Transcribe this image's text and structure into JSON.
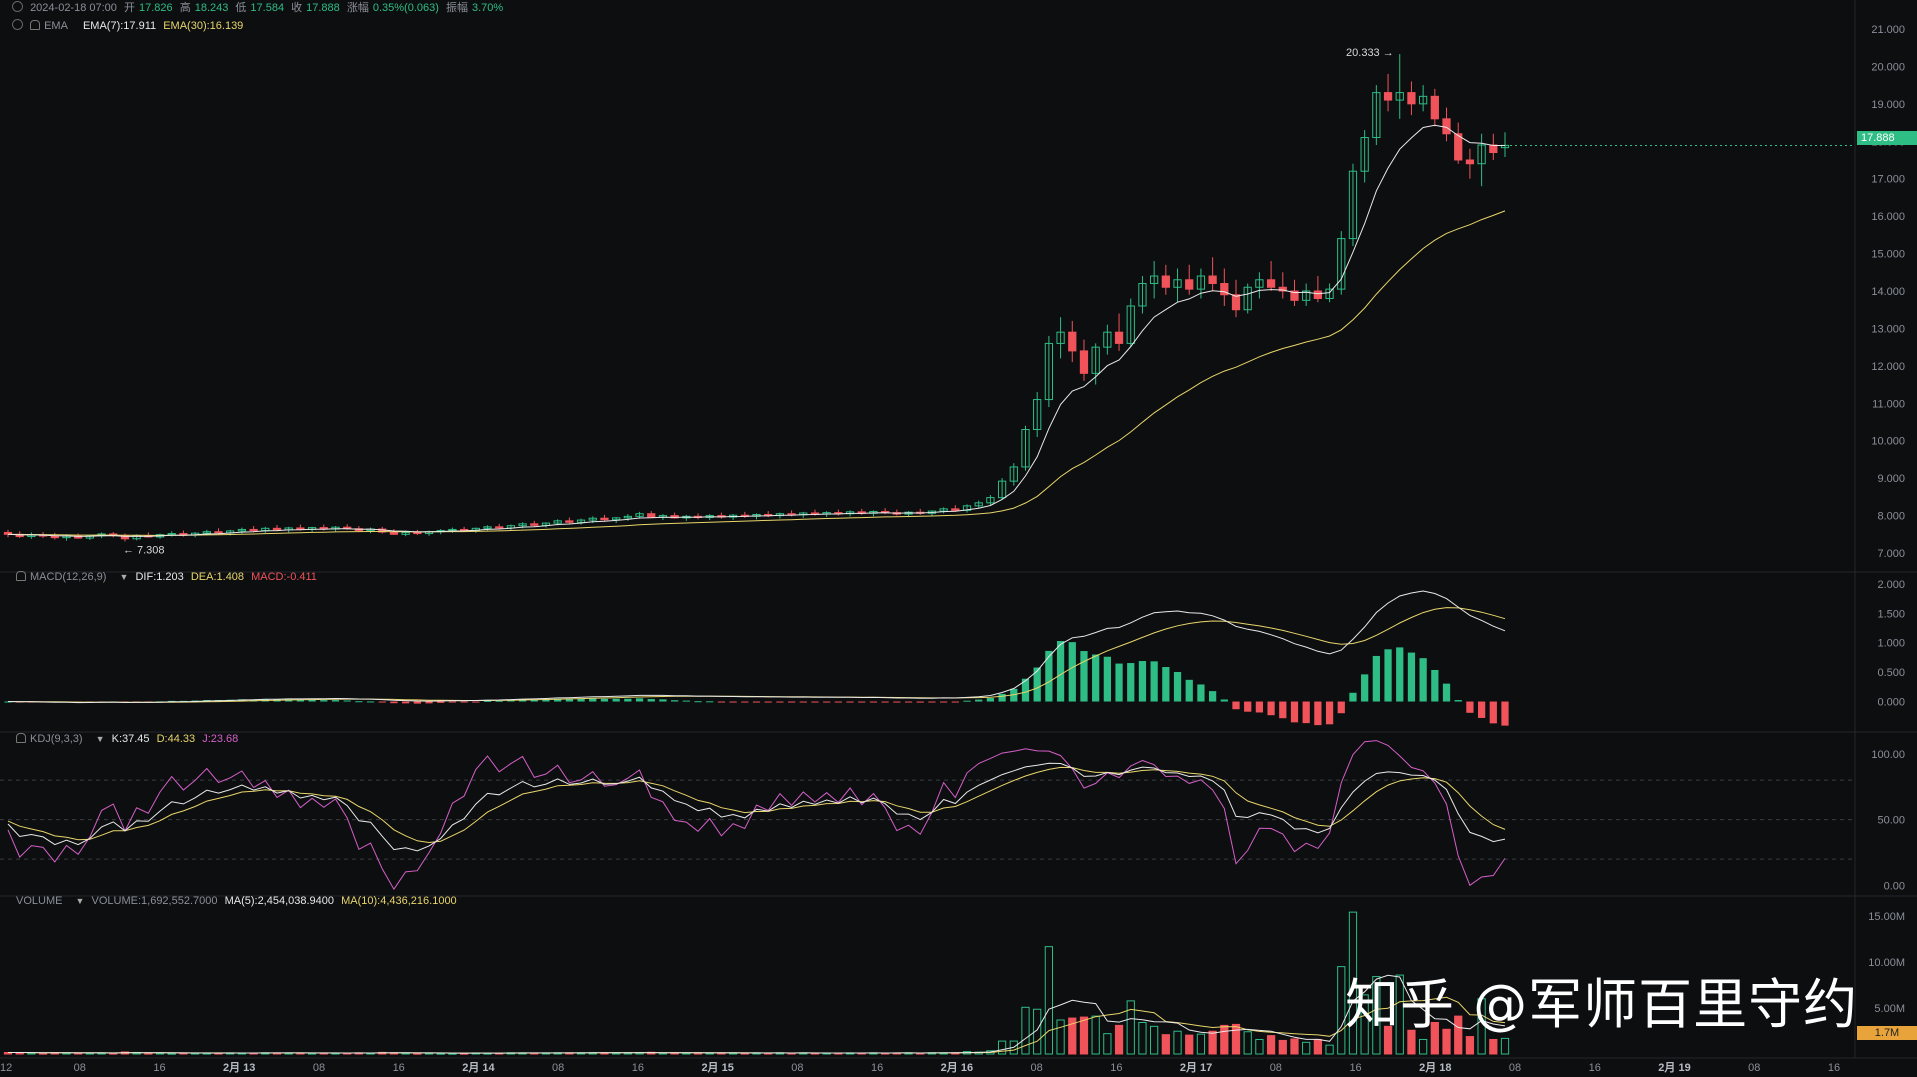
{
  "header": {
    "date": "2024-02-18 07:00",
    "open_label": "开",
    "open": "17.826",
    "high_label": "高",
    "high": "18.243",
    "low_label": "低",
    "low": "17.584",
    "close_label": "收",
    "close": "17.888",
    "change_label": "涨幅",
    "change": "0.35%(0.063)",
    "amp_label": "振幅",
    "amp": "3.70%"
  },
  "ema_legend": {
    "name": "EMA",
    "ema7": "EMA(7):17.911",
    "ema30": "EMA(30):16.139"
  },
  "macd_legend": {
    "name": "MACD(12,26,9)",
    "dif": "DIF:1.203",
    "dea": "DEA:1.408",
    "macd": "MACD:-0.411"
  },
  "kdj_legend": {
    "name": "KDJ(9,3,3)",
    "k": "K:37.45",
    "d": "D:44.33",
    "j": "J:23.68"
  },
  "vol_legend": {
    "name": "VOLUME",
    "vol": "VOLUME:1,692,552.7000",
    "ma5": "MA(5):2,454,038.9400",
    "ma10": "MA(10):4,436,216.1000"
  },
  "annotations": {
    "high_marker": "20.333",
    "low_marker": "7.308"
  },
  "current_price_tag": "17.888",
  "current_volume_tag": "1.7M",
  "watermark": "知乎 @军师百里守约",
  "colors": {
    "up": "#2ebd85",
    "down": "#f0535a",
    "ema7": "#e9e9e9",
    "ema30": "#e8d56a",
    "dea": "#e8d56a",
    "j": "#d45fc8",
    "price_tag": "#2ebd85",
    "vol_tag": "#e8a33a",
    "bg": "#0d0e10"
  },
  "chart_data": [
    {
      "type": "candlestick",
      "title": "",
      "overlays": [
        "EMA(7)",
        "EMA(30)"
      ],
      "y_ticks": [
        "21.000",
        "20.000",
        "19.000",
        "18.000",
        "17.000",
        "16.000",
        "15.000",
        "14.000",
        "13.000",
        "12.000",
        "11.000",
        "10.000",
        "9.000",
        "8.000",
        "7.000"
      ],
      "ylim": [
        6.6,
        21.4
      ],
      "x_ticks": [
        "12",
        "08",
        "16",
        "2月 13",
        "08",
        "16",
        "2月 14",
        "08",
        "16",
        "2月 15",
        "08",
        "16",
        "2月 16",
        "08",
        "16",
        "2月 17",
        "08",
        "16",
        "2月 18",
        "08",
        "16",
        "2月 19",
        "08",
        "16"
      ],
      "ohlc": [
        [
          7.55,
          7.62,
          7.42,
          7.5
        ],
        [
          7.5,
          7.58,
          7.4,
          7.44
        ],
        [
          7.44,
          7.55,
          7.38,
          7.48
        ],
        [
          7.48,
          7.56,
          7.4,
          7.46
        ],
        [
          7.46,
          7.54,
          7.36,
          7.41
        ],
        [
          7.41,
          7.5,
          7.33,
          7.45
        ],
        [
          7.45,
          7.52,
          7.38,
          7.4
        ],
        [
          7.4,
          7.48,
          7.35,
          7.46
        ],
        [
          7.46,
          7.55,
          7.4,
          7.51
        ],
        [
          7.51,
          7.56,
          7.42,
          7.47
        ],
        [
          7.47,
          7.52,
          7.31,
          7.38
        ],
        [
          7.38,
          7.5,
          7.34,
          7.47
        ],
        [
          7.47,
          7.55,
          7.41,
          7.43
        ],
        [
          7.43,
          7.52,
          7.38,
          7.49
        ],
        [
          7.49,
          7.58,
          7.44,
          7.52
        ],
        [
          7.52,
          7.6,
          7.44,
          7.48
        ],
        [
          7.48,
          7.56,
          7.42,
          7.53
        ],
        [
          7.53,
          7.62,
          7.47,
          7.57
        ],
        [
          7.57,
          7.66,
          7.5,
          7.54
        ],
        [
          7.54,
          7.62,
          7.47,
          7.59
        ],
        [
          7.59,
          7.68,
          7.52,
          7.63
        ],
        [
          7.63,
          7.72,
          7.55,
          7.6
        ],
        [
          7.6,
          7.7,
          7.54,
          7.66
        ],
        [
          7.66,
          7.75,
          7.58,
          7.62
        ],
        [
          7.62,
          7.7,
          7.55,
          7.67
        ],
        [
          7.67,
          7.76,
          7.6,
          7.63
        ],
        [
          7.63,
          7.7,
          7.57,
          7.68
        ],
        [
          7.68,
          7.76,
          7.6,
          7.64
        ],
        [
          7.64,
          7.72,
          7.58,
          7.69
        ],
        [
          7.69,
          7.77,
          7.62,
          7.65
        ],
        [
          7.65,
          7.72,
          7.56,
          7.6
        ],
        [
          7.6,
          7.68,
          7.53,
          7.64
        ],
        [
          7.64,
          7.7,
          7.52,
          7.56
        ],
        [
          7.56,
          7.64,
          7.48,
          7.5
        ],
        [
          7.5,
          7.6,
          7.45,
          7.55
        ],
        [
          7.55,
          7.62,
          7.48,
          7.52
        ],
        [
          7.52,
          7.6,
          7.46,
          7.57
        ],
        [
          7.57,
          7.64,
          7.5,
          7.6
        ],
        [
          7.6,
          7.68,
          7.54,
          7.63
        ],
        [
          7.63,
          7.7,
          7.56,
          7.6
        ],
        [
          7.6,
          7.68,
          7.54,
          7.66
        ],
        [
          7.66,
          7.74,
          7.6,
          7.7
        ],
        [
          7.7,
          7.78,
          7.62,
          7.67
        ],
        [
          7.67,
          7.76,
          7.6,
          7.73
        ],
        [
          7.73,
          7.82,
          7.66,
          7.78
        ],
        [
          7.78,
          7.86,
          7.7,
          7.74
        ],
        [
          7.74,
          7.82,
          7.68,
          7.8
        ],
        [
          7.8,
          7.9,
          7.74,
          7.86
        ],
        [
          7.86,
          7.95,
          7.78,
          7.82
        ],
        [
          7.82,
          7.92,
          7.76,
          7.88
        ],
        [
          7.88,
          7.98,
          7.8,
          7.93
        ],
        [
          7.93,
          8.02,
          7.84,
          7.89
        ],
        [
          7.89,
          7.96,
          7.8,
          7.94
        ],
        [
          7.94,
          8.04,
          7.86,
          7.98
        ],
        [
          7.98,
          8.1,
          7.92,
          8.05
        ],
        [
          8.05,
          8.12,
          7.94,
          7.96
        ],
        [
          7.96,
          8.04,
          7.88,
          8.0
        ],
        [
          8.0,
          8.08,
          7.92,
          7.94
        ],
        [
          7.94,
          8.02,
          7.86,
          7.98
        ],
        [
          7.98,
          8.06,
          7.9,
          7.95
        ],
        [
          7.95,
          8.04,
          7.88,
          8.0
        ],
        [
          8.0,
          8.08,
          7.92,
          7.96
        ],
        [
          7.96,
          8.04,
          7.88,
          8.01
        ],
        [
          8.01,
          8.1,
          7.94,
          7.98
        ],
        [
          7.98,
          8.06,
          7.9,
          8.03
        ],
        [
          8.03,
          8.12,
          7.96,
          8.0
        ],
        [
          8.0,
          8.08,
          7.92,
          8.05
        ],
        [
          8.05,
          8.14,
          7.98,
          8.02
        ],
        [
          8.02,
          8.1,
          7.94,
          8.07
        ],
        [
          8.07,
          8.16,
          8.0,
          8.04
        ],
        [
          8.04,
          8.12,
          7.96,
          8.08
        ],
        [
          8.08,
          8.16,
          8.0,
          8.05
        ],
        [
          8.05,
          8.14,
          7.98,
          8.1
        ],
        [
          8.1,
          8.18,
          8.02,
          8.06
        ],
        [
          8.06,
          8.14,
          7.98,
          8.11
        ],
        [
          8.11,
          8.2,
          8.04,
          8.08
        ],
        [
          8.08,
          8.16,
          8.0,
          8.04
        ],
        [
          8.04,
          8.12,
          7.96,
          8.09
        ],
        [
          8.09,
          8.18,
          8.02,
          8.06
        ],
        [
          8.06,
          8.14,
          7.98,
          8.12
        ],
        [
          8.12,
          8.22,
          8.06,
          8.18
        ],
        [
          8.18,
          8.28,
          8.1,
          8.14
        ],
        [
          8.14,
          8.3,
          8.08,
          8.26
        ],
        [
          8.26,
          8.4,
          8.2,
          8.34
        ],
        [
          8.34,
          8.55,
          8.28,
          8.48
        ],
        [
          8.48,
          9.0,
          8.42,
          8.92
        ],
        [
          8.92,
          9.4,
          8.8,
          9.3
        ],
        [
          9.3,
          10.4,
          9.2,
          10.3
        ],
        [
          10.3,
          11.3,
          10.1,
          11.1
        ],
        [
          11.1,
          12.8,
          10.9,
          12.6
        ],
        [
          12.6,
          13.3,
          12.2,
          12.9
        ],
        [
          12.9,
          13.2,
          12.1,
          12.4
        ],
        [
          12.4,
          12.7,
          11.6,
          11.8
        ],
        [
          11.8,
          12.6,
          11.5,
          12.5
        ],
        [
          12.5,
          13.1,
          12.3,
          12.9
        ],
        [
          12.9,
          13.4,
          12.4,
          12.6
        ],
        [
          12.6,
          13.8,
          12.5,
          13.6
        ],
        [
          13.6,
          14.4,
          13.4,
          14.2
        ],
        [
          14.2,
          14.8,
          13.8,
          14.4
        ],
        [
          14.4,
          14.7,
          13.9,
          14.1
        ],
        [
          14.1,
          14.6,
          13.7,
          14.3
        ],
        [
          14.3,
          14.7,
          13.9,
          14.05
        ],
        [
          14.05,
          14.6,
          13.8,
          14.4
        ],
        [
          14.4,
          14.9,
          14.0,
          14.2
        ],
        [
          14.2,
          14.6,
          13.6,
          13.9
        ],
        [
          13.9,
          14.3,
          13.3,
          13.5
        ],
        [
          13.5,
          14.2,
          13.4,
          14.1
        ],
        [
          14.1,
          14.5,
          13.8,
          14.3
        ],
        [
          14.3,
          14.8,
          14.0,
          14.1
        ],
        [
          14.1,
          14.5,
          13.8,
          14.0
        ],
        [
          14.0,
          14.3,
          13.6,
          13.75
        ],
        [
          13.75,
          14.2,
          13.6,
          14.0
        ],
        [
          14.0,
          14.4,
          13.7,
          13.8
        ],
        [
          13.8,
          14.2,
          13.7,
          14.05
        ],
        [
          14.05,
          15.6,
          13.9,
          15.4
        ],
        [
          15.4,
          17.4,
          15.2,
          17.2
        ],
        [
          17.2,
          18.3,
          16.9,
          18.1
        ],
        [
          18.1,
          19.5,
          17.9,
          19.3
        ],
        [
          19.3,
          19.8,
          18.8,
          19.1
        ],
        [
          19.1,
          20.33,
          18.6,
          19.3
        ],
        [
          19.3,
          19.6,
          18.7,
          19.0
        ],
        [
          19.0,
          19.5,
          18.8,
          19.2
        ],
        [
          19.2,
          19.4,
          18.4,
          18.6
        ],
        [
          18.6,
          18.9,
          18.0,
          18.2
        ],
        [
          18.2,
          18.5,
          17.4,
          17.5
        ],
        [
          17.5,
          17.8,
          17.0,
          17.4
        ],
        [
          17.4,
          18.2,
          16.8,
          17.9
        ],
        [
          17.9,
          18.2,
          17.5,
          17.7
        ],
        [
          17.83,
          18.24,
          17.58,
          17.89
        ]
      ],
      "ema7_last": 17.911,
      "ema30_last": 16.139
    },
    {
      "type": "macd",
      "y_ticks": [
        "2.000",
        "1.500",
        "1.000",
        "0.500",
        "0.000"
      ],
      "ylim": [
        -0.45,
        2.1
      ],
      "dif": 1.203,
      "dea": 1.408,
      "macd": -0.411
    },
    {
      "type": "kdj",
      "y_ticks": [
        "100.00",
        "50.00",
        "0.00"
      ],
      "ylim": [
        -5,
        112
      ],
      "k": 37.45,
      "d": 44.33,
      "j": 23.68
    },
    {
      "type": "volume",
      "y_ticks": [
        "15.00M",
        "10.00M",
        "5.00M"
      ],
      "ylim": [
        0,
        16.5
      ],
      "volume": 1692552.7,
      "ma5": 2454038.94,
      "ma10": 4436216.1
    }
  ]
}
